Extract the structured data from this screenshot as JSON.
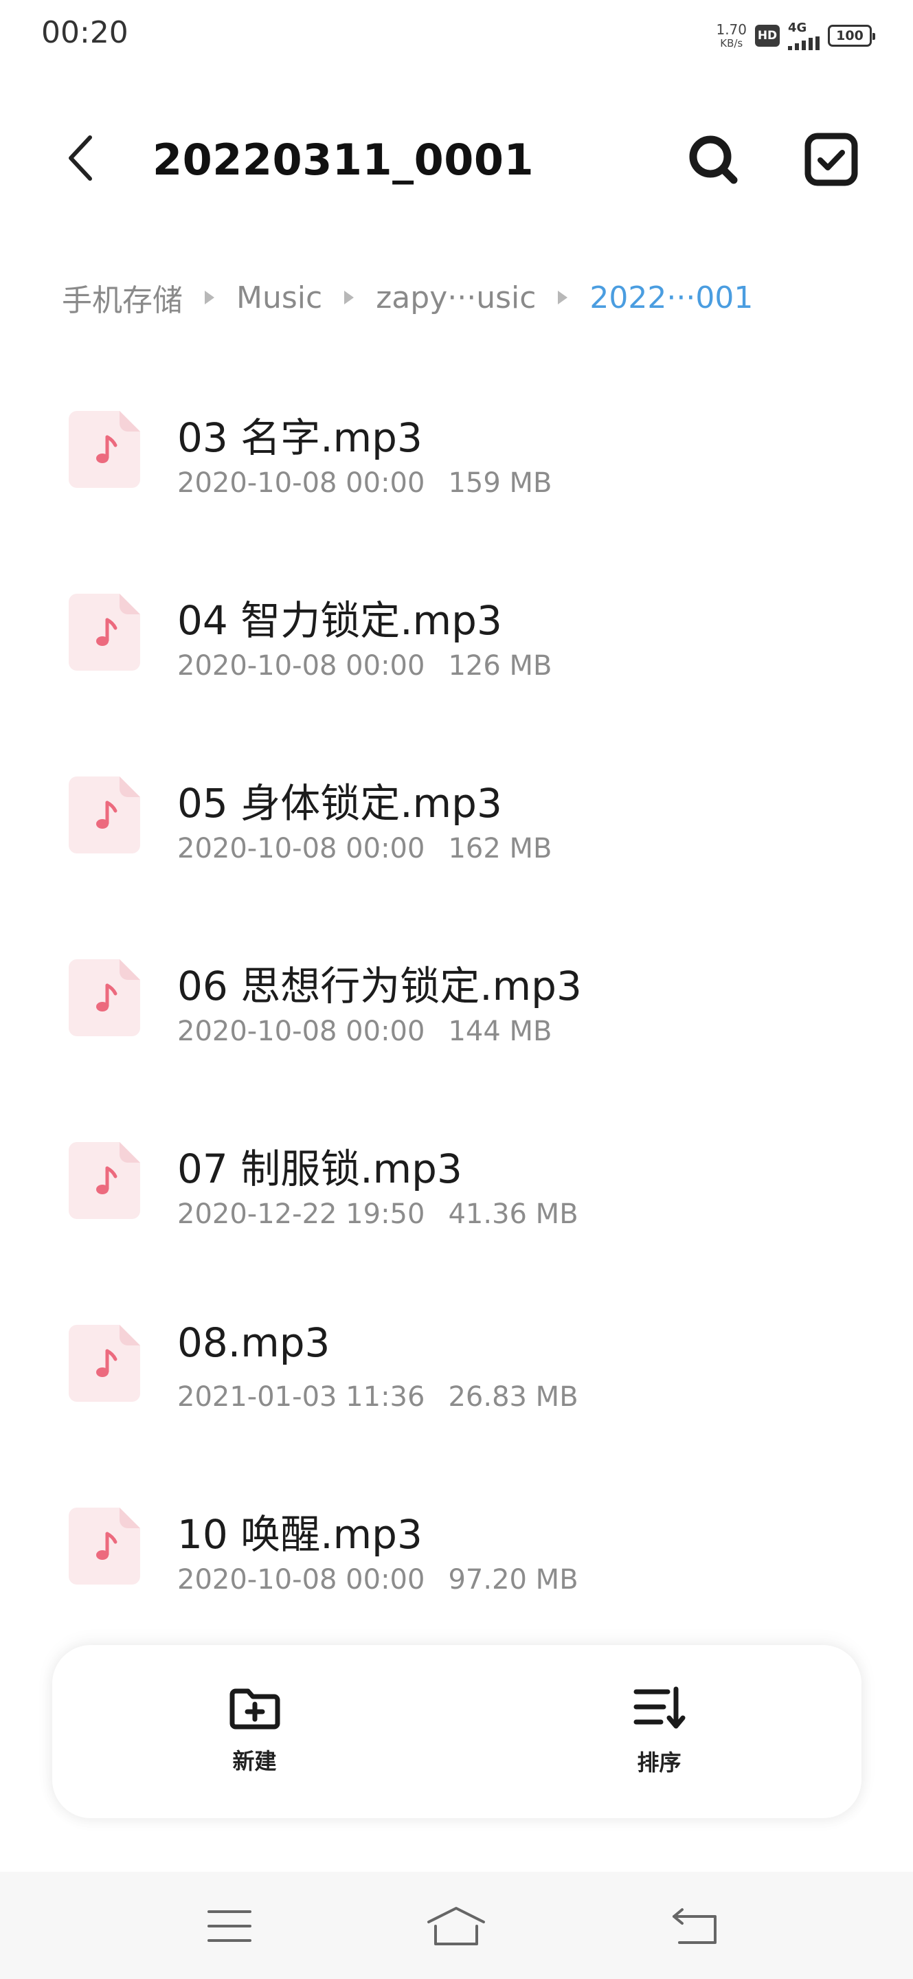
{
  "status_bar": {
    "time": "00:20",
    "net_speed_value": "1.70",
    "net_speed_unit": "KB/s",
    "hd_label": "HD",
    "network_type": "4G",
    "battery_level": "100"
  },
  "header": {
    "title": "20220311_0001",
    "back_icon": "chevron-left-icon",
    "search_icon": "search-icon",
    "select_icon": "checkbox-icon"
  },
  "breadcrumb": [
    {
      "label": "手机存储"
    },
    {
      "label": "Music"
    },
    {
      "label": "zapy···usic"
    },
    {
      "label": "2022···001"
    }
  ],
  "files": [
    {
      "name": "03 名字.mp3",
      "date": "2020-10-08 00:00",
      "size": "159 MB"
    },
    {
      "name": "04 智力锁定.mp3",
      "date": "2020-10-08 00:00",
      "size": "126 MB"
    },
    {
      "name": "05 身体锁定.mp3",
      "date": "2020-10-08 00:00",
      "size": "162 MB"
    },
    {
      "name": "06 思想行为锁定.mp3",
      "date": "2020-10-08 00:00",
      "size": "144 MB"
    },
    {
      "name": "07 制服锁.mp3",
      "date": "2020-12-22 19:50",
      "size": "41.36 MB"
    },
    {
      "name": "08.mp3",
      "date": "2021-01-03 11:36",
      "size": "26.83 MB"
    },
    {
      "name": "10 唤醒.mp3",
      "date": "2020-10-08 00:00",
      "size": "97.20 MB"
    }
  ],
  "actions": {
    "new_label": "新建",
    "new_icon": "new-folder-icon",
    "sort_label": "排序",
    "sort_icon": "sort-icon"
  },
  "nav_bar": {
    "menu_icon": "menu-icon",
    "home_icon": "home-icon",
    "back_icon": "back-icon"
  },
  "colors": {
    "accent": "#4a9de0",
    "file_icon_bg": "#fbeaec",
    "file_icon_fold": "#f6d3d8",
    "file_icon_note": "#ec6a7e",
    "secondary_text": "#8c8c8c"
  }
}
